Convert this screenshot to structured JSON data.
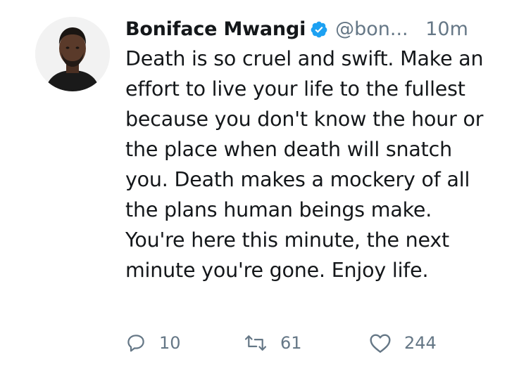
{
  "tweet": {
    "author_name": "Boniface Mwangi",
    "handle": "@bon...",
    "time": "10m",
    "verified": true,
    "text": "Death is so cruel and swift. Make an effort to live your life to the fullest because you don't know the hour or the place when death will snatch you. Death makes a mockery of all the plans human beings make. You're here this minute, the next minute you're gone. Enjoy life."
  },
  "actions": {
    "reply_count": "10",
    "retweet_count": "61",
    "like_count": "244"
  },
  "colors": {
    "text": "#14171a",
    "secondary": "#657786",
    "verified": "#1da1f2"
  },
  "icons": {
    "avatar": "profile-photo",
    "verified": "verified-badge-icon",
    "reply": "speech-bubble-icon",
    "retweet": "retweet-arrows-icon",
    "like": "heart-outline-icon"
  }
}
